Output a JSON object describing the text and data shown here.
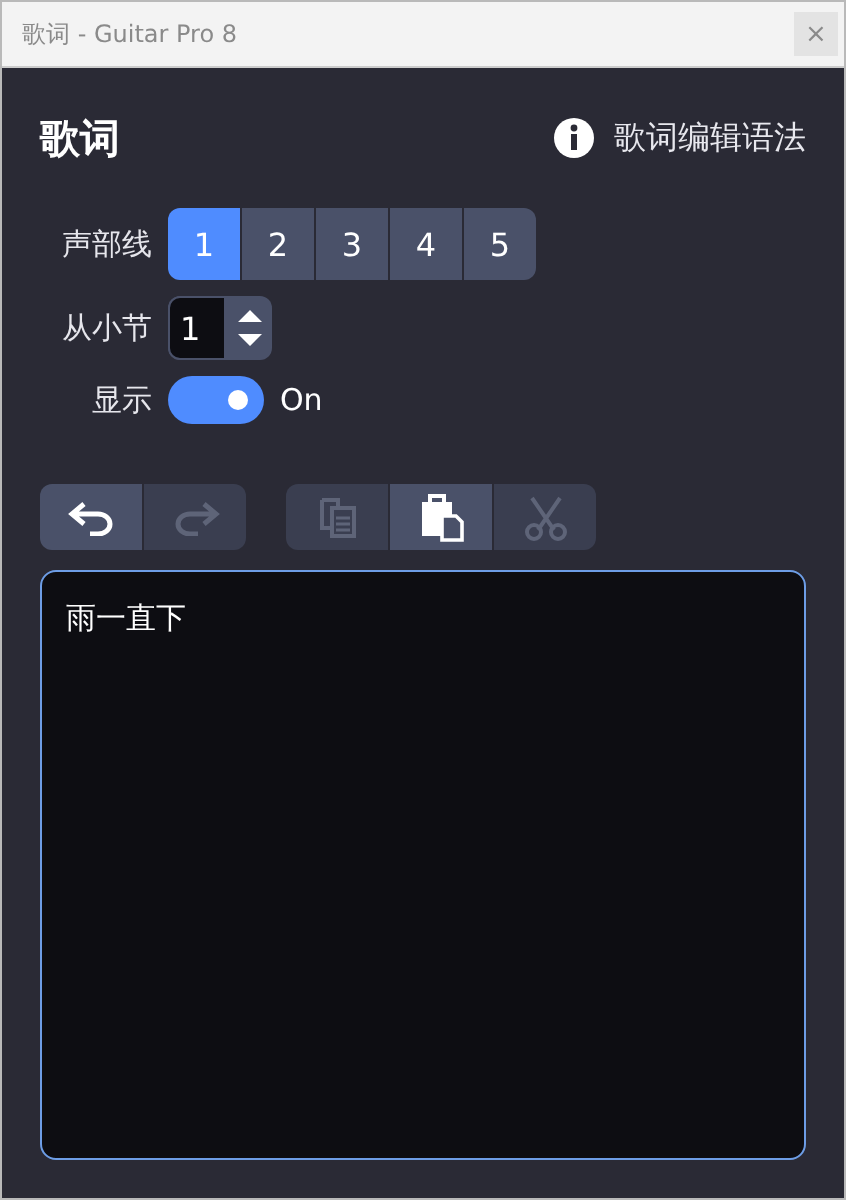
{
  "window": {
    "title": "歌词 - Guitar Pro 8",
    "close": "×"
  },
  "heading": "歌词",
  "help_link": "歌词编辑语法",
  "voices": {
    "label": "声部线",
    "options": [
      {
        "label": "1",
        "selected": true
      },
      {
        "label": "2",
        "selected": false
      },
      {
        "label": "3",
        "selected": false
      },
      {
        "label": "4",
        "selected": false
      },
      {
        "label": "5",
        "selected": false
      }
    ]
  },
  "start_bar": {
    "label": "从小节",
    "value": "1"
  },
  "display": {
    "label": "显示",
    "on": true,
    "state_text": "On"
  },
  "toolbar": [
    [
      {
        "kind": "undo",
        "disabled": false
      },
      {
        "kind": "redo",
        "disabled": true
      }
    ],
    [
      {
        "kind": "copy",
        "disabled": true
      },
      {
        "kind": "paste",
        "disabled": false
      },
      {
        "kind": "cut",
        "disabled": true
      }
    ]
  ],
  "editor": {
    "value": "雨一直下"
  }
}
